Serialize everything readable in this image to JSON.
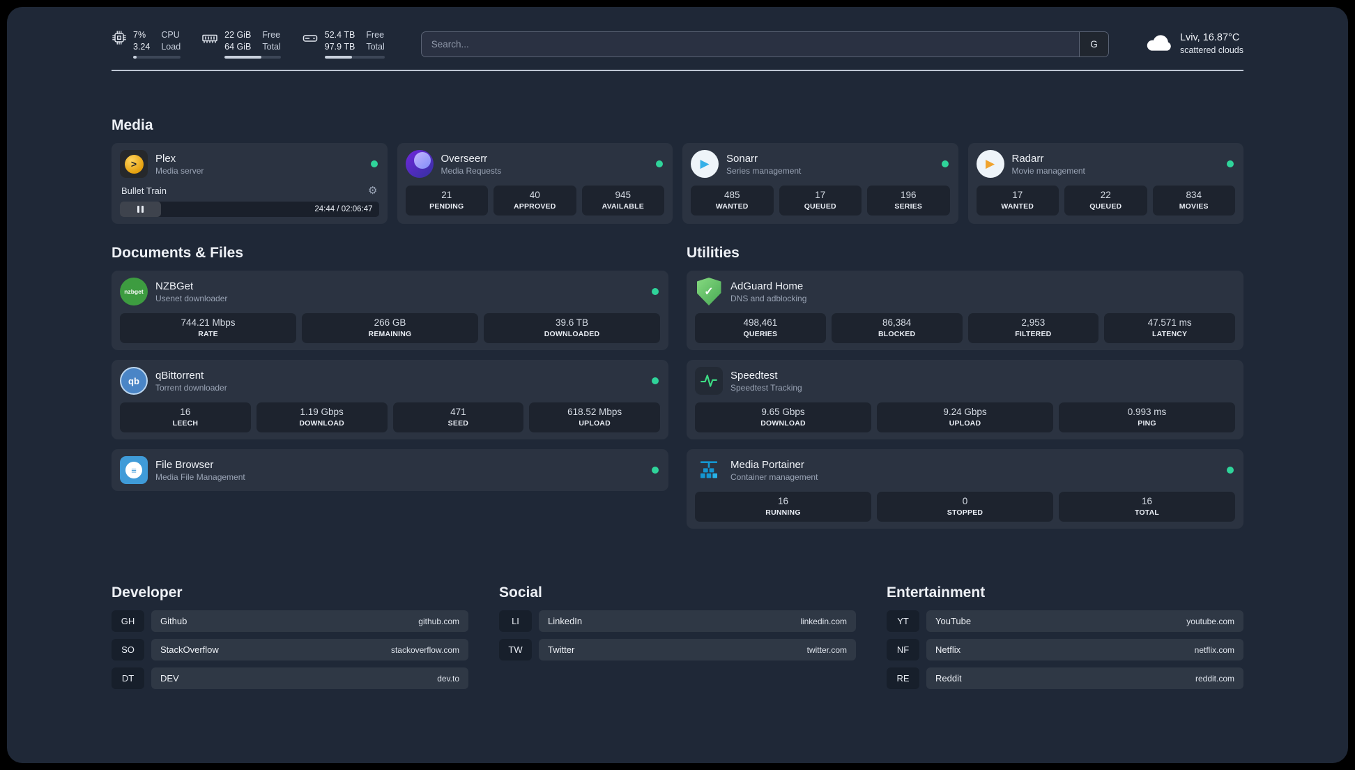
{
  "topbar": {
    "resources": [
      {
        "id": "cpu",
        "value1": "7%",
        "value2": "3.24",
        "label1": "CPU",
        "label2": "Load",
        "percent": 7
      },
      {
        "id": "memory",
        "value1": "22 GiB",
        "value2": "64 GiB",
        "label1": "Free",
        "label2": "Total",
        "percent": 66
      },
      {
        "id": "disk",
        "value1": "52.4 TB",
        "value2": "97.9 TB",
        "label1": "Free",
        "label2": "Total",
        "percent": 46
      }
    ],
    "search": {
      "placeholder": "Search...",
      "provider": "G"
    },
    "weather": {
      "location": "Lviv, 16.87°C",
      "condition": "scattered clouds"
    }
  },
  "sections": {
    "media": {
      "title": "Media",
      "cards": [
        {
          "name": "Plex",
          "description": "Media server",
          "online": true,
          "player": {
            "title": "Bullet Train",
            "time": "24:44 / 02:06:47",
            "progress_percent": 16
          }
        },
        {
          "name": "Overseerr",
          "description": "Media Requests",
          "online": true,
          "stats": [
            {
              "value": "21",
              "label": "PENDING"
            },
            {
              "value": "40",
              "label": "APPROVED"
            },
            {
              "value": "945",
              "label": "AVAILABLE"
            }
          ]
        },
        {
          "name": "Sonarr",
          "description": "Series management",
          "online": true,
          "stats": [
            {
              "value": "485",
              "label": "WANTED"
            },
            {
              "value": "17",
              "label": "QUEUED"
            },
            {
              "value": "196",
              "label": "SERIES"
            }
          ]
        },
        {
          "name": "Radarr",
          "description": "Movie management",
          "online": true,
          "stats": [
            {
              "value": "17",
              "label": "WANTED"
            },
            {
              "value": "22",
              "label": "QUEUED"
            },
            {
              "value": "834",
              "label": "MOVIES"
            }
          ]
        }
      ]
    },
    "documents": {
      "title": "Documents & Files",
      "cards": [
        {
          "name": "NZBGet",
          "description": "Usenet downloader",
          "online": true,
          "stats": [
            {
              "value": "744.21 Mbps",
              "label": "RATE"
            },
            {
              "value": "266 GB",
              "label": "REMAINING"
            },
            {
              "value": "39.6 TB",
              "label": "DOWNLOADED"
            }
          ]
        },
        {
          "name": "qBittorrent",
          "description": "Torrent downloader",
          "online": true,
          "stats": [
            {
              "value": "16",
              "label": "LEECH"
            },
            {
              "value": "1.19 Gbps",
              "label": "DOWNLOAD"
            },
            {
              "value": "471",
              "label": "SEED"
            },
            {
              "value": "618.52 Mbps",
              "label": "UPLOAD"
            }
          ]
        },
        {
          "name": "File Browser",
          "description": "Media File Management",
          "online": true
        }
      ]
    },
    "utilities": {
      "title": "Utilities",
      "cards": [
        {
          "name": "AdGuard Home",
          "description": "DNS and adblocking",
          "stats": [
            {
              "value": "498,461",
              "label": "QUERIES"
            },
            {
              "value": "86,384",
              "label": "BLOCKED"
            },
            {
              "value": "2,953",
              "label": "FILTERED"
            },
            {
              "value": "47.571 ms",
              "label": "LATENCY"
            }
          ]
        },
        {
          "name": "Speedtest",
          "description": "Speedtest Tracking",
          "stats": [
            {
              "value": "9.65 Gbps",
              "label": "DOWNLOAD"
            },
            {
              "value": "9.24 Gbps",
              "label": "UPLOAD"
            },
            {
              "value": "0.993 ms",
              "label": "PING"
            }
          ]
        },
        {
          "name": "Media Portainer",
          "description": "Container management",
          "online": true,
          "stats": [
            {
              "value": "16",
              "label": "RUNNING"
            },
            {
              "value": "0",
              "label": "STOPPED"
            },
            {
              "value": "16",
              "label": "TOTAL"
            }
          ]
        }
      ]
    }
  },
  "bookmarks": [
    {
      "title": "Developer",
      "items": [
        {
          "abbr": "GH",
          "name": "Github",
          "url": "github.com"
        },
        {
          "abbr": "SO",
          "name": "StackOverflow",
          "url": "stackoverflow.com"
        },
        {
          "abbr": "DT",
          "name": "DEV",
          "url": "dev.to"
        }
      ]
    },
    {
      "title": "Social",
      "items": [
        {
          "abbr": "LI",
          "name": "LinkedIn",
          "url": "linkedin.com"
        },
        {
          "abbr": "TW",
          "name": "Twitter",
          "url": "twitter.com"
        }
      ]
    },
    {
      "title": "Entertainment",
      "items": [
        {
          "abbr": "YT",
          "name": "YouTube",
          "url": "youtube.com"
        },
        {
          "abbr": "NF",
          "name": "Netflix",
          "url": "netflix.com"
        },
        {
          "abbr": "RE",
          "name": "Reddit",
          "url": "reddit.com"
        }
      ]
    }
  ],
  "icon_glyphs": {
    "plex": ">",
    "sonarr": "▶",
    "radarr": "▶",
    "nzbget": "nzbget",
    "qbittorrent": "qb",
    "filebrowser": "≡",
    "adguard": "✓",
    "gear": "⚙"
  },
  "colors": {
    "background": "#1f2837",
    "status_online": "#2fd49a",
    "plex_amber": "#e5a00d",
    "speedtest_green": "#3ddc84",
    "portainer_blue": "#1496d1"
  }
}
